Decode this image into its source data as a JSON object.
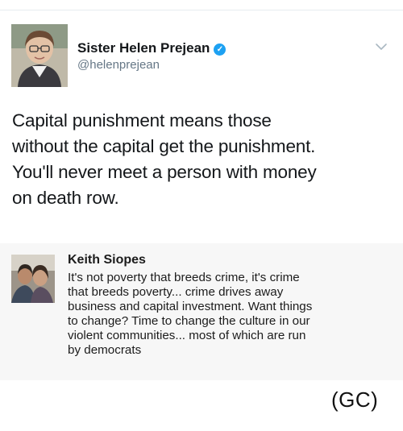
{
  "tweet": {
    "author_name": "Sister Helen Prejean",
    "verified_icon": "verified-badge-icon",
    "handle": "@helenprejean",
    "menu_icon": "chevron-down-icon",
    "text_lines": [
      "Capital punishment means those",
      "without the capital get the punishment.",
      "You'll never meet a person with money",
      "on death row."
    ]
  },
  "reply": {
    "author_name": "Keith Siopes",
    "text_lines": [
      "It's not poverty that breeds crime, it's crime",
      "that breeds poverty... crime drives away",
      "business and capital investment. Want things",
      "to change? Time to change the culture in our",
      "violent communities... most of which are run",
      "by democrats"
    ]
  },
  "caption": "(GC)",
  "colors": {
    "verified": "#1da1f2",
    "handle": "#657786",
    "reply_background": "#f7f7f7"
  }
}
